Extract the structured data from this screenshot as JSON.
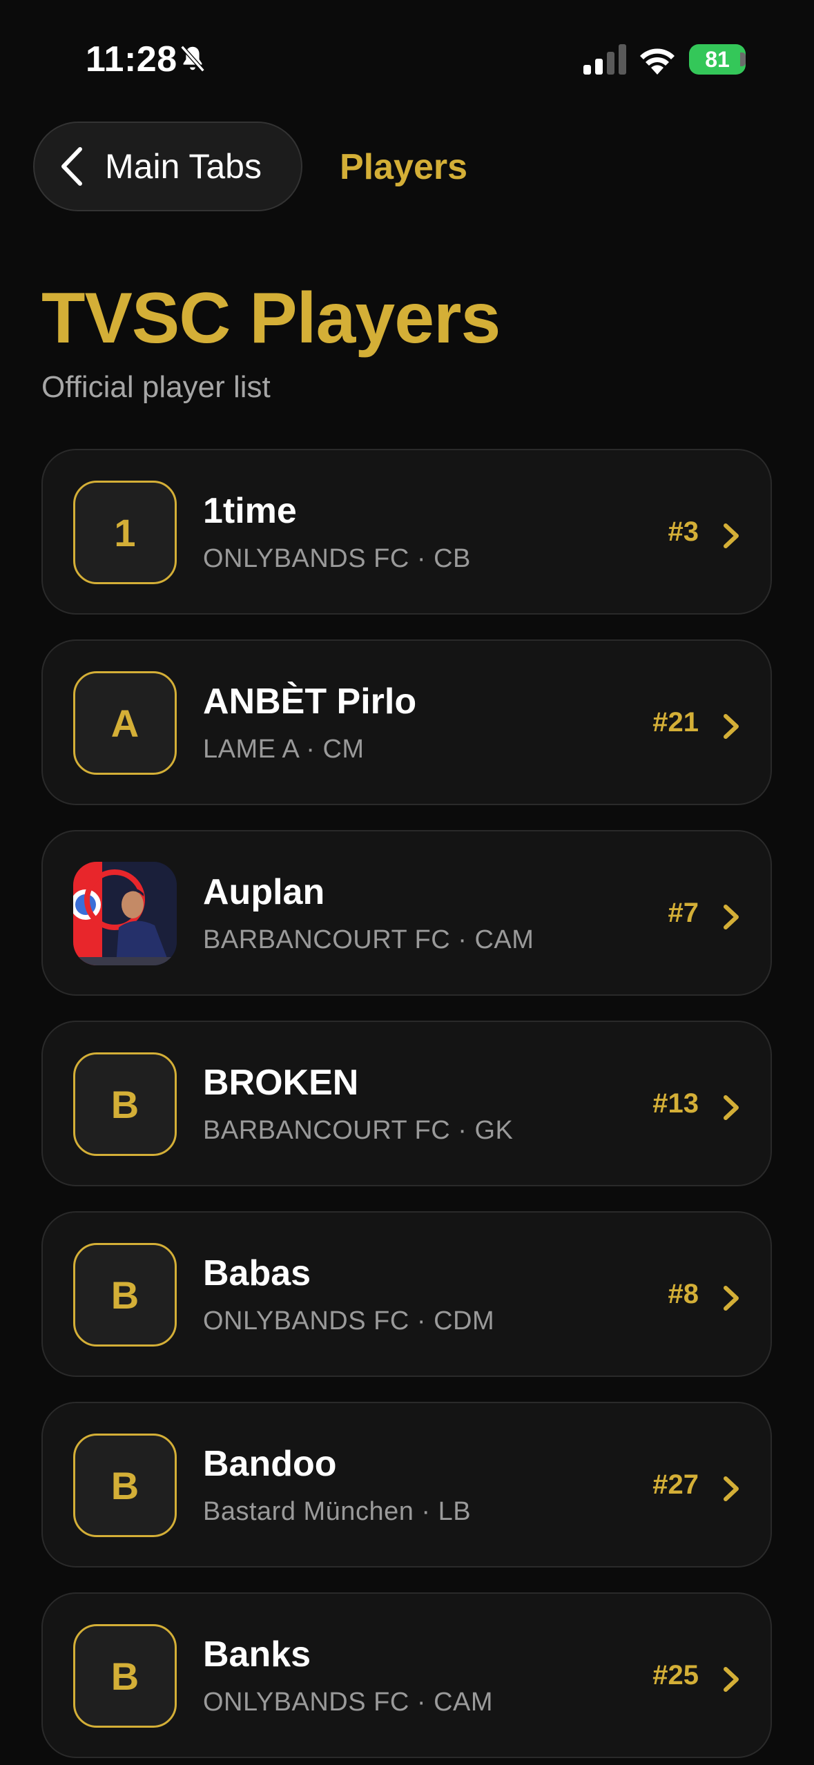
{
  "status_bar": {
    "time": "11:28",
    "battery": "81"
  },
  "nav": {
    "back_label": "Main Tabs",
    "title": "Players"
  },
  "header": {
    "title": "TVSC Players",
    "subtitle": "Official player list"
  },
  "colors": {
    "accent": "#d4af37",
    "background": "#0b0b0b",
    "card": "#141414",
    "battery": "#34c759"
  },
  "players": [
    {
      "initial": "1",
      "name": "1time",
      "meta": "ONLYBANDS FC · CB",
      "number": "#3",
      "photo": false
    },
    {
      "initial": "A",
      "name": "ANBÈT Pirlo",
      "meta": "LAME A · CM",
      "number": "#21",
      "photo": false
    },
    {
      "initial": "",
      "name": "Auplan",
      "meta": "BARBANCOURT FC · CAM",
      "number": "#7",
      "photo": true
    },
    {
      "initial": "B",
      "name": "BROKEN",
      "meta": "BARBANCOURT FC · GK",
      "number": "#13",
      "photo": false
    },
    {
      "initial": "B",
      "name": "Babas",
      "meta": "ONLYBANDS FC · CDM",
      "number": "#8",
      "photo": false
    },
    {
      "initial": "B",
      "name": "Bandoo",
      "meta": "Bastard München · LB",
      "number": "#27",
      "photo": false
    },
    {
      "initial": "B",
      "name": "Banks",
      "meta": "ONLYBANDS FC · CAM",
      "number": "#25",
      "photo": false
    }
  ]
}
